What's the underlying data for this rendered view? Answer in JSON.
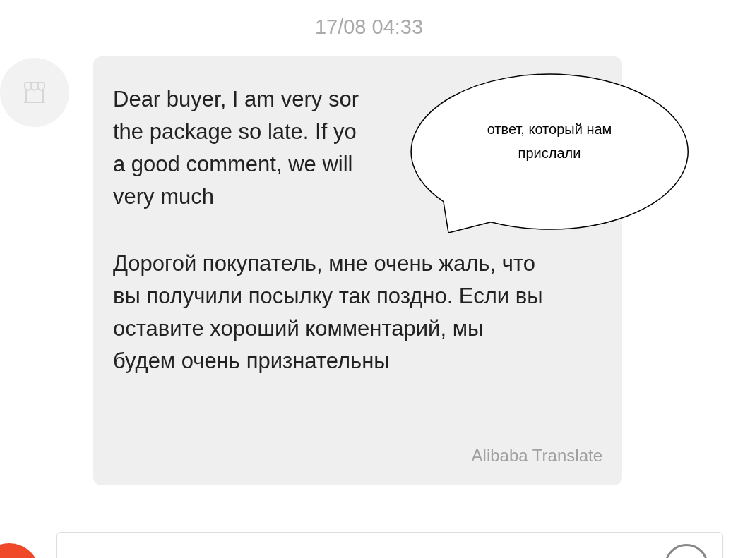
{
  "timestamp": "17/08 04:33",
  "message": {
    "original_lines": [
      "Dear buyer, I am very sor",
      "the package so late. If yo",
      "a good comment, we will",
      "very much"
    ],
    "translation": "Дорогой покупатель, мне очень жаль, что вы получили посылку так поздно. Если вы оставите хороший комментарий, мы будем очень признательны",
    "translator": "Alibaba Translate"
  },
  "callout": {
    "text": "ответ, который нам прислали"
  }
}
